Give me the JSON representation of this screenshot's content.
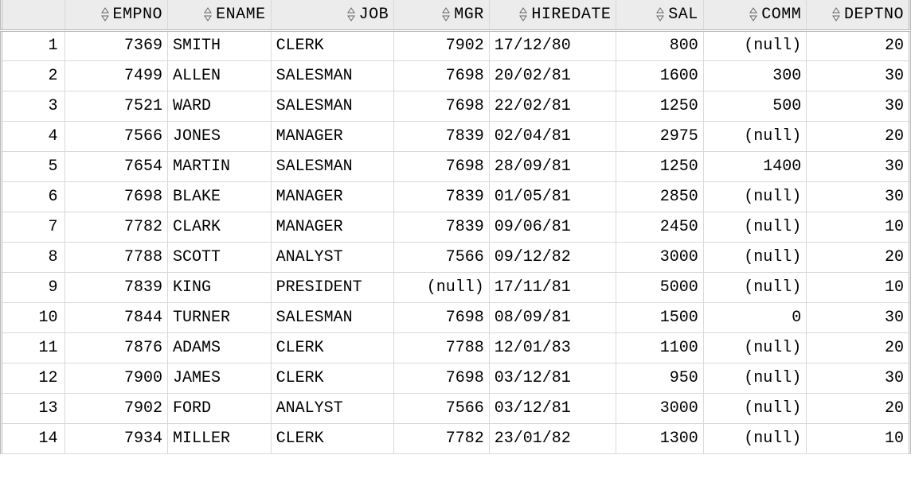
{
  "null_display": "(null)",
  "columns": [
    {
      "key": "EMPNO",
      "label": "EMPNO",
      "type": "num",
      "cls": "c-empno"
    },
    {
      "key": "ENAME",
      "label": "ENAME",
      "type": "txt",
      "cls": "c-ename"
    },
    {
      "key": "JOB",
      "label": "JOB",
      "type": "txt",
      "cls": "c-job"
    },
    {
      "key": "MGR",
      "label": "MGR",
      "type": "num",
      "cls": "c-mgr"
    },
    {
      "key": "HIREDATE",
      "label": "HIREDATE",
      "type": "txt",
      "cls": "c-hired"
    },
    {
      "key": "SAL",
      "label": "SAL",
      "type": "num",
      "cls": "c-sal"
    },
    {
      "key": "COMM",
      "label": "COMM",
      "type": "num",
      "cls": "c-comm"
    },
    {
      "key": "DEPTNO",
      "label": "DEPTNO",
      "type": "num",
      "cls": "c-deptno"
    }
  ],
  "rows": [
    {
      "EMPNO": 7369,
      "ENAME": "SMITH",
      "JOB": "CLERK",
      "MGR": 7902,
      "HIREDATE": "17/12/80",
      "SAL": 800,
      "COMM": null,
      "DEPTNO": 20
    },
    {
      "EMPNO": 7499,
      "ENAME": "ALLEN",
      "JOB": "SALESMAN",
      "MGR": 7698,
      "HIREDATE": "20/02/81",
      "SAL": 1600,
      "COMM": 300,
      "DEPTNO": 30
    },
    {
      "EMPNO": 7521,
      "ENAME": "WARD",
      "JOB": "SALESMAN",
      "MGR": 7698,
      "HIREDATE": "22/02/81",
      "SAL": 1250,
      "COMM": 500,
      "DEPTNO": 30
    },
    {
      "EMPNO": 7566,
      "ENAME": "JONES",
      "JOB": "MANAGER",
      "MGR": 7839,
      "HIREDATE": "02/04/81",
      "SAL": 2975,
      "COMM": null,
      "DEPTNO": 20
    },
    {
      "EMPNO": 7654,
      "ENAME": "MARTIN",
      "JOB": "SALESMAN",
      "MGR": 7698,
      "HIREDATE": "28/09/81",
      "SAL": 1250,
      "COMM": 1400,
      "DEPTNO": 30
    },
    {
      "EMPNO": 7698,
      "ENAME": "BLAKE",
      "JOB": "MANAGER",
      "MGR": 7839,
      "HIREDATE": "01/05/81",
      "SAL": 2850,
      "COMM": null,
      "DEPTNO": 30
    },
    {
      "EMPNO": 7782,
      "ENAME": "CLARK",
      "JOB": "MANAGER",
      "MGR": 7839,
      "HIREDATE": "09/06/81",
      "SAL": 2450,
      "COMM": null,
      "DEPTNO": 10
    },
    {
      "EMPNO": 7788,
      "ENAME": "SCOTT",
      "JOB": "ANALYST",
      "MGR": 7566,
      "HIREDATE": "09/12/82",
      "SAL": 3000,
      "COMM": null,
      "DEPTNO": 20
    },
    {
      "EMPNO": 7839,
      "ENAME": "KING",
      "JOB": "PRESIDENT",
      "MGR": null,
      "HIREDATE": "17/11/81",
      "SAL": 5000,
      "COMM": null,
      "DEPTNO": 10
    },
    {
      "EMPNO": 7844,
      "ENAME": "TURNER",
      "JOB": "SALESMAN",
      "MGR": 7698,
      "HIREDATE": "08/09/81",
      "SAL": 1500,
      "COMM": 0,
      "DEPTNO": 30
    },
    {
      "EMPNO": 7876,
      "ENAME": "ADAMS",
      "JOB": "CLERK",
      "MGR": 7788,
      "HIREDATE": "12/01/83",
      "SAL": 1100,
      "COMM": null,
      "DEPTNO": 20
    },
    {
      "EMPNO": 7900,
      "ENAME": "JAMES",
      "JOB": "CLERK",
      "MGR": 7698,
      "HIREDATE": "03/12/81",
      "SAL": 950,
      "COMM": null,
      "DEPTNO": 30
    },
    {
      "EMPNO": 7902,
      "ENAME": "FORD",
      "JOB": "ANALYST",
      "MGR": 7566,
      "HIREDATE": "03/12/81",
      "SAL": 3000,
      "COMM": null,
      "DEPTNO": 20
    },
    {
      "EMPNO": 7934,
      "ENAME": "MILLER",
      "JOB": "CLERK",
      "MGR": 7782,
      "HIREDATE": "23/01/82",
      "SAL": 1300,
      "COMM": null,
      "DEPTNO": 10
    }
  ]
}
